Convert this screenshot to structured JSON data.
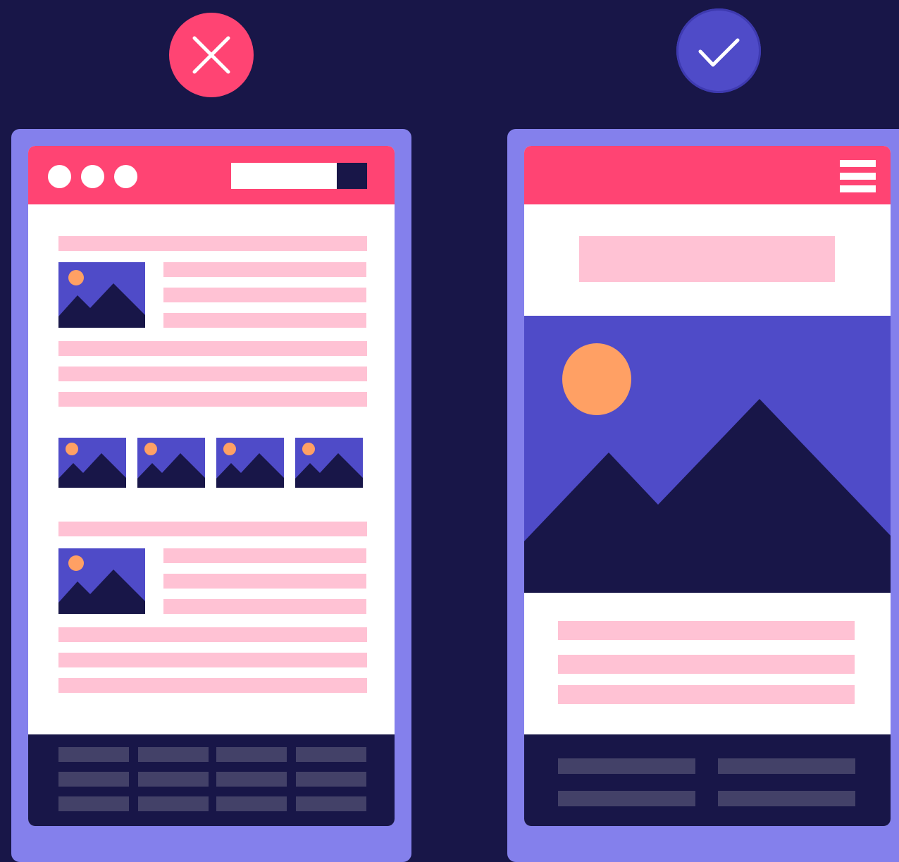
{
  "colors": {
    "background": "#181648",
    "frame": "#8480EC",
    "header": "#FF4473",
    "screen": "#FFFFFF",
    "text_placeholder": "#FFC2D4",
    "footer": "#181648",
    "footer_placeholder": "#434168",
    "image_sky": "#4F4BC8",
    "image_sun": "#FFA064",
    "image_mountain": "#181648",
    "bad_badge": "#FF4473",
    "good_badge": "#4F4BC8"
  },
  "bad_example": {
    "badge_icon": "close-icon",
    "header_dots": [
      "window-dot",
      "window-dot",
      "window-dot"
    ],
    "header_search": "search-field"
  },
  "good_example": {
    "badge_icon": "check-icon",
    "header_menu_icon": "hamburger-menu-icon"
  }
}
